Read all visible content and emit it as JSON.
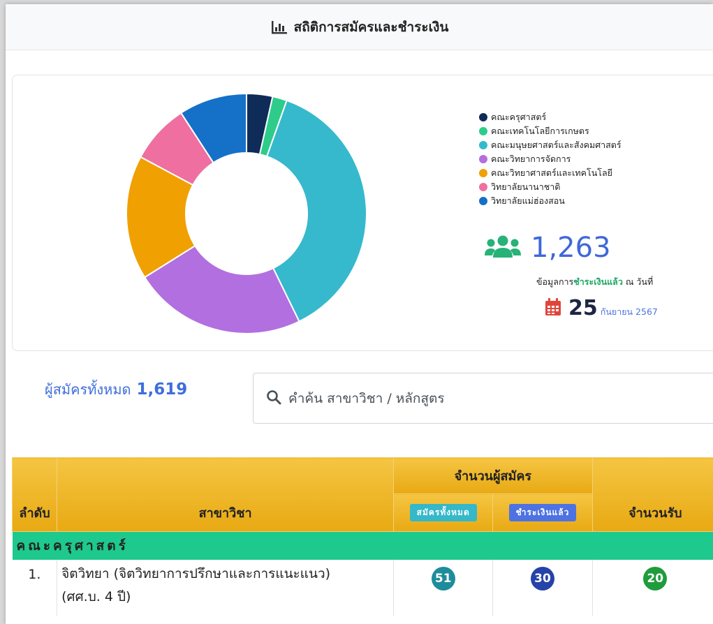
{
  "header": {
    "title": "สถิติการสมัครและชำระเงิน",
    "icon": "bar-chart-icon"
  },
  "chart_data": {
    "type": "pie",
    "categories": [
      "คณะครุศาสตร์",
      "คณะเทคโนโลยีการเกษตร",
      "คณะมนุษยศาสตร์และสังคมศาสตร์",
      "คณะวิทยาการจัดการ",
      "คณะวิทยาศาสตร์และเทคโนโลยี",
      "วิทยาลัยนานาชาติ",
      "วิทยาลัยแม่ฮ่องสอน"
    ],
    "values": [
      45,
      25,
      480,
      300,
      215,
      103,
      118
    ],
    "colors": [
      "#0f2c59",
      "#2ecc8a",
      "#36b9cc",
      "#b26fe0",
      "#f0a000",
      "#ee6fa0",
      "#1570c8"
    ],
    "donut": true,
    "legend": "right"
  },
  "paid": {
    "count": "1,263",
    "icon": "users-icon",
    "note_prefix": "ข้อมูลการ",
    "note_highlight": "ชำระเงินแล้ว",
    "note_suffix": " ณ วันที่",
    "day": "25",
    "month_year": "กันยายน 2567",
    "calendar_icon": "calendar-icon"
  },
  "totals": {
    "label": "ผู้สมัครทั้งหมด",
    "value": "1,619"
  },
  "search": {
    "placeholder": "คำค้น สาขาวิชา / หลักสูตร",
    "icon": "search-icon"
  },
  "table": {
    "col_no": "ลำดับ",
    "col_major": "สาขาวิชา",
    "col_applicants": "จำนวนผู้สมัคร",
    "sub_all": "สมัครทั้งหมด",
    "sub_paid": "ชำระเงินแล้ว",
    "col_quota": "จำนวนรับ",
    "faculty": "คณะครุศาสตร์",
    "rows": [
      {
        "no": "1.",
        "major_line1": "จิตวิทยา (จิตวิทยาการปรึกษาและการแนะแนว)",
        "major_line2": "(ศศ.บ. 4 ปี)",
        "applied": "51",
        "paid": "30",
        "quota": "20"
      }
    ]
  }
}
